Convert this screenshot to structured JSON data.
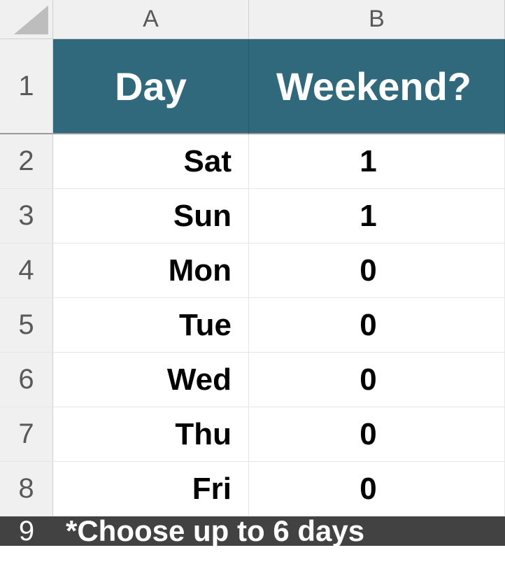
{
  "columns": [
    "A",
    "B"
  ],
  "row_labels": [
    "1",
    "2",
    "3",
    "4",
    "5",
    "6",
    "7",
    "8",
    "9"
  ],
  "table": {
    "headers": {
      "A": "Day",
      "B": "Weekend?"
    },
    "rows": [
      {
        "day": "Sat",
        "weekend": "1"
      },
      {
        "day": "Sun",
        "weekend": "1"
      },
      {
        "day": "Mon",
        "weekend": "0"
      },
      {
        "day": "Tue",
        "weekend": "0"
      },
      {
        "day": "Wed",
        "weekend": "0"
      },
      {
        "day": "Thu",
        "weekend": "0"
      },
      {
        "day": "Fri",
        "weekend": "0"
      }
    ],
    "footer": "*Choose up to 6 days"
  },
  "colors": {
    "header_bg": "#31697c",
    "footer_bg": "#424242"
  }
}
